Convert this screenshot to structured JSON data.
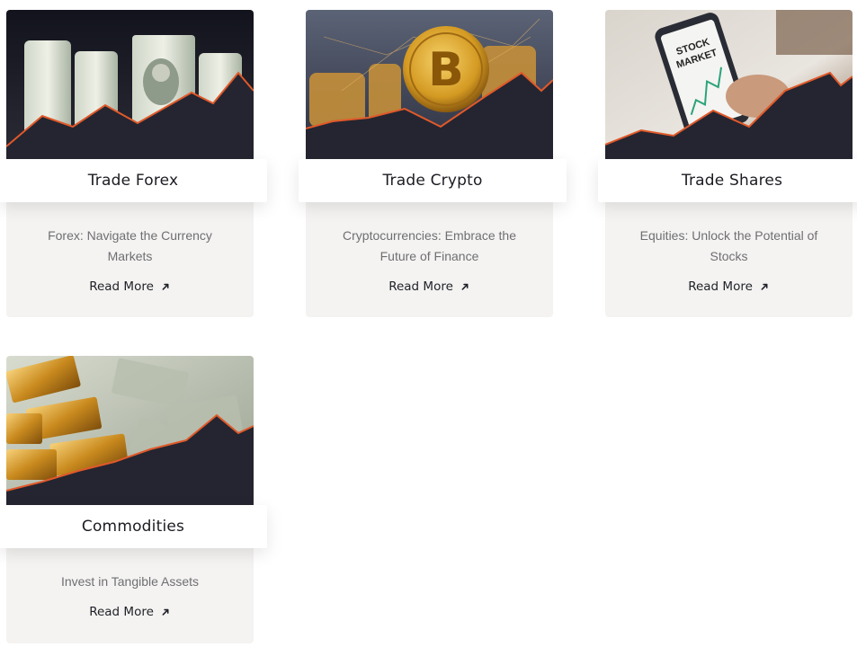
{
  "cards": [
    {
      "title": "Trade Forex",
      "description": "Forex: Navigate the Currency Markets",
      "link_label": "Read More",
      "arrow_icon": "↘",
      "image": "dollar-bills-icon"
    },
    {
      "title": "Trade Crypto",
      "description": "Cryptocurrencies: Embrace the Future of Finance",
      "link_label": "Read More",
      "arrow_icon": "↘",
      "image": "bitcoin-coin-icon"
    },
    {
      "title": "Trade Shares",
      "description": "Equities: Unlock the Potential of Stocks",
      "link_label": "Read More",
      "arrow_icon": "↘",
      "image": "stock-market-phone-icon",
      "image_text": [
        "STOCK",
        "MARKET"
      ]
    },
    {
      "title": "Commodities",
      "description": "Invest in Tangible Assets",
      "link_label": "Read More",
      "arrow_icon": "↘",
      "image": "gold-bars-icon"
    }
  ],
  "colors": {
    "dark_navy": "#22232f",
    "accent_orange": "#e0592a",
    "card_body": "#f4f3f1"
  }
}
